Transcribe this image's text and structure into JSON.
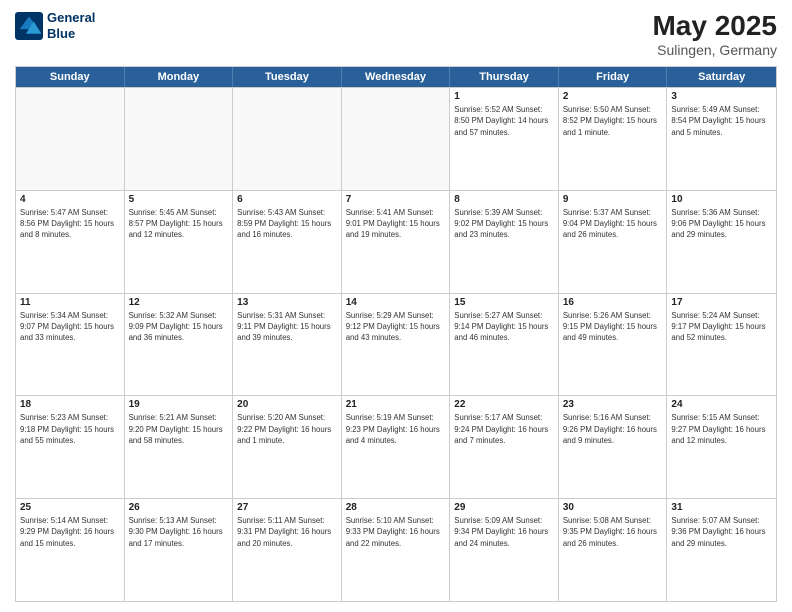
{
  "header": {
    "logo_line1": "General",
    "logo_line2": "Blue",
    "title": "May 2025",
    "subtitle": "Sulingen, Germany"
  },
  "days_of_week": [
    "Sunday",
    "Monday",
    "Tuesday",
    "Wednesday",
    "Thursday",
    "Friday",
    "Saturday"
  ],
  "weeks": [
    [
      {
        "day": "",
        "info": ""
      },
      {
        "day": "",
        "info": ""
      },
      {
        "day": "",
        "info": ""
      },
      {
        "day": "",
        "info": ""
      },
      {
        "day": "1",
        "info": "Sunrise: 5:52 AM\nSunset: 8:50 PM\nDaylight: 14 hours\nand 57 minutes."
      },
      {
        "day": "2",
        "info": "Sunrise: 5:50 AM\nSunset: 8:52 PM\nDaylight: 15 hours\nand 1 minute."
      },
      {
        "day": "3",
        "info": "Sunrise: 5:49 AM\nSunset: 8:54 PM\nDaylight: 15 hours\nand 5 minutes."
      }
    ],
    [
      {
        "day": "4",
        "info": "Sunrise: 5:47 AM\nSunset: 8:56 PM\nDaylight: 15 hours\nand 8 minutes."
      },
      {
        "day": "5",
        "info": "Sunrise: 5:45 AM\nSunset: 8:57 PM\nDaylight: 15 hours\nand 12 minutes."
      },
      {
        "day": "6",
        "info": "Sunrise: 5:43 AM\nSunset: 8:59 PM\nDaylight: 15 hours\nand 16 minutes."
      },
      {
        "day": "7",
        "info": "Sunrise: 5:41 AM\nSunset: 9:01 PM\nDaylight: 15 hours\nand 19 minutes."
      },
      {
        "day": "8",
        "info": "Sunrise: 5:39 AM\nSunset: 9:02 PM\nDaylight: 15 hours\nand 23 minutes."
      },
      {
        "day": "9",
        "info": "Sunrise: 5:37 AM\nSunset: 9:04 PM\nDaylight: 15 hours\nand 26 minutes."
      },
      {
        "day": "10",
        "info": "Sunrise: 5:36 AM\nSunset: 9:06 PM\nDaylight: 15 hours\nand 29 minutes."
      }
    ],
    [
      {
        "day": "11",
        "info": "Sunrise: 5:34 AM\nSunset: 9:07 PM\nDaylight: 15 hours\nand 33 minutes."
      },
      {
        "day": "12",
        "info": "Sunrise: 5:32 AM\nSunset: 9:09 PM\nDaylight: 15 hours\nand 36 minutes."
      },
      {
        "day": "13",
        "info": "Sunrise: 5:31 AM\nSunset: 9:11 PM\nDaylight: 15 hours\nand 39 minutes."
      },
      {
        "day": "14",
        "info": "Sunrise: 5:29 AM\nSunset: 9:12 PM\nDaylight: 15 hours\nand 43 minutes."
      },
      {
        "day": "15",
        "info": "Sunrise: 5:27 AM\nSunset: 9:14 PM\nDaylight: 15 hours\nand 46 minutes."
      },
      {
        "day": "16",
        "info": "Sunrise: 5:26 AM\nSunset: 9:15 PM\nDaylight: 15 hours\nand 49 minutes."
      },
      {
        "day": "17",
        "info": "Sunrise: 5:24 AM\nSunset: 9:17 PM\nDaylight: 15 hours\nand 52 minutes."
      }
    ],
    [
      {
        "day": "18",
        "info": "Sunrise: 5:23 AM\nSunset: 9:18 PM\nDaylight: 15 hours\nand 55 minutes."
      },
      {
        "day": "19",
        "info": "Sunrise: 5:21 AM\nSunset: 9:20 PM\nDaylight: 15 hours\nand 58 minutes."
      },
      {
        "day": "20",
        "info": "Sunrise: 5:20 AM\nSunset: 9:22 PM\nDaylight: 16 hours\nand 1 minute."
      },
      {
        "day": "21",
        "info": "Sunrise: 5:19 AM\nSunset: 9:23 PM\nDaylight: 16 hours\nand 4 minutes."
      },
      {
        "day": "22",
        "info": "Sunrise: 5:17 AM\nSunset: 9:24 PM\nDaylight: 16 hours\nand 7 minutes."
      },
      {
        "day": "23",
        "info": "Sunrise: 5:16 AM\nSunset: 9:26 PM\nDaylight: 16 hours\nand 9 minutes."
      },
      {
        "day": "24",
        "info": "Sunrise: 5:15 AM\nSunset: 9:27 PM\nDaylight: 16 hours\nand 12 minutes."
      }
    ],
    [
      {
        "day": "25",
        "info": "Sunrise: 5:14 AM\nSunset: 9:29 PM\nDaylight: 16 hours\nand 15 minutes."
      },
      {
        "day": "26",
        "info": "Sunrise: 5:13 AM\nSunset: 9:30 PM\nDaylight: 16 hours\nand 17 minutes."
      },
      {
        "day": "27",
        "info": "Sunrise: 5:11 AM\nSunset: 9:31 PM\nDaylight: 16 hours\nand 20 minutes."
      },
      {
        "day": "28",
        "info": "Sunrise: 5:10 AM\nSunset: 9:33 PM\nDaylight: 16 hours\nand 22 minutes."
      },
      {
        "day": "29",
        "info": "Sunrise: 5:09 AM\nSunset: 9:34 PM\nDaylight: 16 hours\nand 24 minutes."
      },
      {
        "day": "30",
        "info": "Sunrise: 5:08 AM\nSunset: 9:35 PM\nDaylight: 16 hours\nand 26 minutes."
      },
      {
        "day": "31",
        "info": "Sunrise: 5:07 AM\nSunset: 9:36 PM\nDaylight: 16 hours\nand 29 minutes."
      }
    ]
  ]
}
